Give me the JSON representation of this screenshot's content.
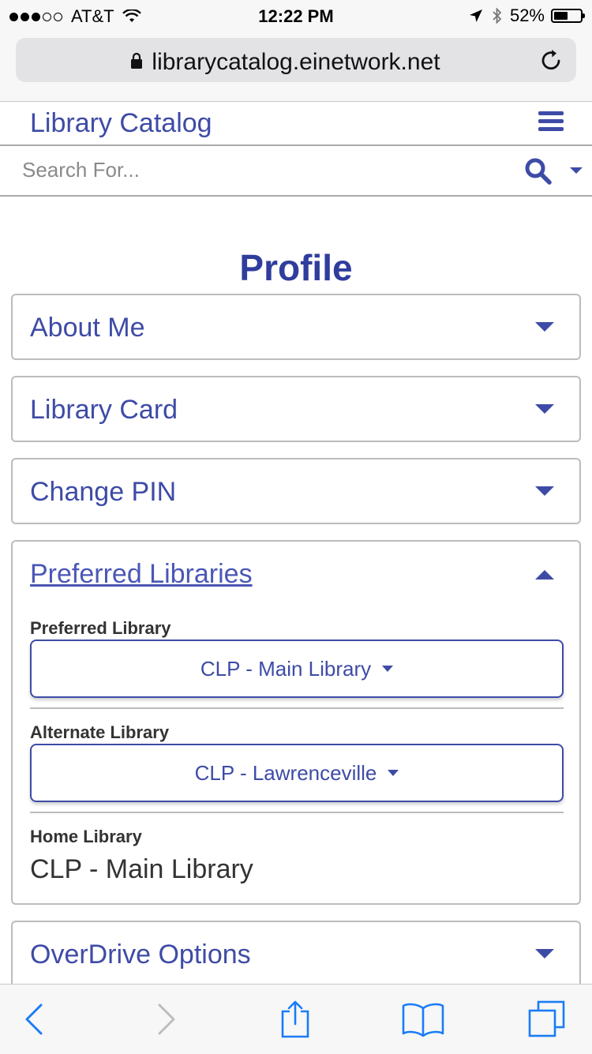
{
  "status_bar": {
    "carrier": "AT&T",
    "time": "12:22 PM",
    "battery_percent": "52%",
    "battery_level": 0.52,
    "signal_bars_filled": 3,
    "signal_bars_total": 5
  },
  "browser": {
    "url": "librarycatalog.einetwork.net"
  },
  "header": {
    "title": "Library Catalog"
  },
  "search": {
    "placeholder": "Search For..."
  },
  "page": {
    "title": "Profile"
  },
  "panels": [
    {
      "title": "About Me",
      "expanded": false
    },
    {
      "title": "Library Card",
      "expanded": false
    },
    {
      "title": "Change PIN",
      "expanded": false
    },
    {
      "title": "Preferred Libraries",
      "expanded": true,
      "preferred_library_label": "Preferred Library",
      "preferred_library_value": "CLP - Main Library",
      "alternate_library_label": "Alternate Library",
      "alternate_library_value": "CLP - Lawrenceville",
      "home_library_label": "Home Library",
      "home_library_value": "CLP - Main Library"
    },
    {
      "title": "OverDrive Options",
      "expanded": false
    }
  ],
  "colors": {
    "accent": "#3e4ba6",
    "heading": "#2f3d9c",
    "ios_blue": "#1a7cf6"
  }
}
